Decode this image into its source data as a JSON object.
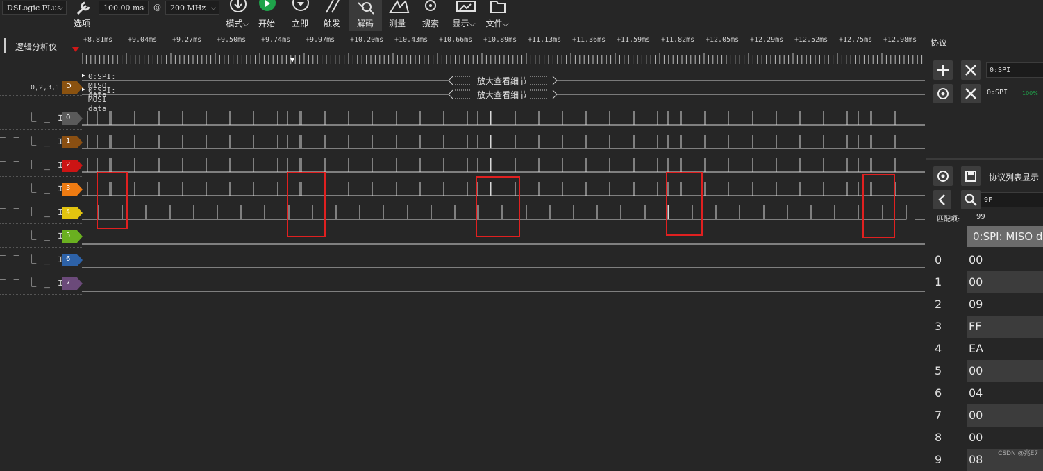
{
  "toolbar": {
    "device": "DSLogic PLus",
    "duration": "100.00 ms",
    "at": "@",
    "rate": "200 MHz",
    "buttons": [
      {
        "label": "选项",
        "icon": "wrench-icon"
      },
      {
        "label": "模式",
        "icon": "download-icon",
        "has_menu": true
      },
      {
        "label": "开始",
        "icon": "play-icon"
      },
      {
        "label": "立即",
        "icon": "instant-icon"
      },
      {
        "label": "触发",
        "icon": "trigger-icon"
      },
      {
        "label": "解码",
        "icon": "decode-icon"
      },
      {
        "label": "测量",
        "icon": "measure-icon"
      },
      {
        "label": "搜索",
        "icon": "search-icon"
      },
      {
        "label": "显示",
        "icon": "display-icon",
        "has_menu": true
      },
      {
        "label": "文件",
        "icon": "file-icon",
        "has_menu": true
      }
    ],
    "accent_start": "#1fa34a"
  },
  "panel": {
    "title": "逻辑分析仪"
  },
  "ruler": {
    "ticks": [
      "+8.81ms",
      "+9.04ms",
      "+9.27ms",
      "+9.50ms",
      "+9.74ms",
      "+9.97ms",
      "+10.20ms",
      "+10.43ms",
      "+10.66ms",
      "+10.89ms",
      "+11.13ms",
      "+11.36ms",
      "+11.59ms",
      "+11.82ms",
      "+12.05ms",
      "+12.29ms",
      "+12.52ms",
      "+12.75ms",
      "+12.98ms"
    ]
  },
  "decoder": {
    "channels_label": "0,2,3,1",
    "tag": "D",
    "rows": [
      "0:SPI: MISO data",
      "0:SPI: MOSI data"
    ],
    "zoom_hint": "放大查看细节"
  },
  "channels": [
    {
      "id": "0",
      "color": "#5a5a5a"
    },
    {
      "id": "1",
      "color": "#8a4f12"
    },
    {
      "id": "2",
      "color": "#cc1414"
    },
    {
      "id": "3",
      "color": "#ee7b12"
    },
    {
      "id": "4",
      "color": "#e3c40f"
    },
    {
      "id": "5",
      "color": "#6ab020"
    },
    {
      "id": "6",
      "color": "#2d62a8"
    },
    {
      "id": "7",
      "color": "#6b4a7a"
    }
  ],
  "channel_symbols": "‾ ‾ ⎿ _ ⌶",
  "right_panel": {
    "title": "协议",
    "decoders": [
      {
        "name": "0:SPI",
        "progress": ""
      },
      {
        "name": "0:SPI",
        "progress": "100%"
      }
    ],
    "list_title": "协议列表显示",
    "search_value": "9F",
    "match_label": "匹配项:",
    "match_count": "99",
    "column_header": "0:SPI: MISO d",
    "rows": [
      {
        "index": "0",
        "value": "00"
      },
      {
        "index": "1",
        "value": "00"
      },
      {
        "index": "2",
        "value": "09"
      },
      {
        "index": "3",
        "value": "FF"
      },
      {
        "index": "4",
        "value": "EA"
      },
      {
        "index": "5",
        "value": "00"
      },
      {
        "index": "6",
        "value": "04"
      },
      {
        "index": "7",
        "value": "00"
      },
      {
        "index": "8",
        "value": "00"
      },
      {
        "index": "9",
        "value": "08"
      }
    ]
  },
  "watermark": "CSDN @兆E7",
  "highlight_color": "#e02020"
}
